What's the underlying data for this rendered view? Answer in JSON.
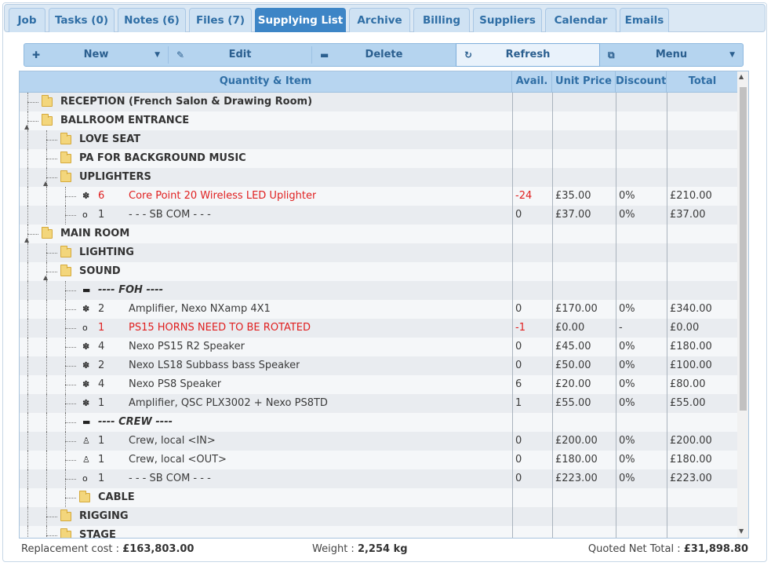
{
  "tabs": [
    {
      "label": "Job",
      "active": false
    },
    {
      "label": "Tasks (0)",
      "active": false
    },
    {
      "label": "Notes (6)",
      "active": false
    },
    {
      "label": "Files (7)",
      "active": false
    },
    {
      "label": "Supplying List",
      "active": true
    },
    {
      "label": "Archive",
      "active": false
    },
    {
      "label": "Billing",
      "active": false
    },
    {
      "label": "Suppliers",
      "active": false
    },
    {
      "label": "Calendar",
      "active": false
    },
    {
      "label": "Emails",
      "active": false
    }
  ],
  "toolbar": {
    "new_label": "New",
    "edit_label": "Edit",
    "delete_label": "Delete",
    "refresh_label": "Refresh",
    "menu_label": "Menu"
  },
  "columns": {
    "item": "Quantity & Item",
    "avail": "Avail.",
    "unit_price": "Unit Price",
    "discount": "Discount",
    "total": "Total"
  },
  "rows": [
    {
      "kind": "group",
      "level": 0,
      "expand": "",
      "label": "RECEPTION (French Salon & Drawing Room)"
    },
    {
      "kind": "group",
      "level": 0,
      "expand": "▲",
      "label": "BALLROOM ENTRANCE"
    },
    {
      "kind": "group",
      "level": 1,
      "expand": "",
      "label": "LOVE SEAT"
    },
    {
      "kind": "group",
      "level": 1,
      "expand": "",
      "label": "PA FOR BACKGROUND MUSIC"
    },
    {
      "kind": "group",
      "level": 1,
      "expand": "▲",
      "label": "UPLIGHTERS"
    },
    {
      "kind": "item",
      "level": 2,
      "icon": "✽",
      "icon_name": "gear-icon",
      "qty": "6",
      "name": "Core Point 20 Wireless LED Uplighter",
      "avail": "-24",
      "unit_price": "£35.00",
      "discount": "0%",
      "total": "£210.00",
      "red": true
    },
    {
      "kind": "item",
      "level": 2,
      "icon": "o",
      "icon_name": "circle-icon",
      "qty": "1",
      "name": "- - - SB COM - - -",
      "avail": "0",
      "unit_price": "£37.00",
      "discount": "0%",
      "total": "£37.00",
      "red": false
    },
    {
      "kind": "group",
      "level": 0,
      "expand": "▲",
      "label": "MAIN ROOM"
    },
    {
      "kind": "group",
      "level": 1,
      "expand": "",
      "label": "LIGHTING"
    },
    {
      "kind": "group",
      "level": 1,
      "expand": "▲",
      "label": "SOUND"
    },
    {
      "kind": "comment",
      "level": 2,
      "icon": "▬",
      "icon_name": "comment-icon",
      "label": "---- FOH ----"
    },
    {
      "kind": "item",
      "level": 2,
      "icon": "✽",
      "icon_name": "gear-icon",
      "qty": "2",
      "name": "Amplifier, Nexo NXamp 4X1",
      "avail": "0",
      "unit_price": "£170.00",
      "discount": "0%",
      "total": "£340.00",
      "red": false
    },
    {
      "kind": "item",
      "level": 2,
      "icon": "o",
      "icon_name": "circle-icon",
      "qty": "1",
      "name": "PS15 HORNS NEED TO BE ROTATED",
      "avail": "-1",
      "unit_price": "£0.00",
      "discount": "-",
      "total": "£0.00",
      "red": true
    },
    {
      "kind": "item",
      "level": 2,
      "icon": "✽",
      "icon_name": "gear-icon",
      "qty": "4",
      "name": "Nexo PS15 R2 Speaker",
      "avail": "0",
      "unit_price": "£45.00",
      "discount": "0%",
      "total": "£180.00",
      "red": false
    },
    {
      "kind": "item",
      "level": 2,
      "icon": "✽",
      "icon_name": "gear-icon",
      "qty": "2",
      "name": "Nexo LS18 Subbass bass Speaker",
      "avail": "0",
      "unit_price": "£50.00",
      "discount": "0%",
      "total": "£100.00",
      "red": false
    },
    {
      "kind": "item",
      "level": 2,
      "icon": "✽",
      "icon_name": "gear-icon",
      "qty": "4",
      "name": "Nexo PS8 Speaker",
      "avail": "6",
      "unit_price": "£20.00",
      "discount": "0%",
      "total": "£80.00",
      "red": false
    },
    {
      "kind": "item",
      "level": 2,
      "icon": "✽",
      "icon_name": "gear-icon",
      "qty": "1",
      "name": "Amplifier, QSC PLX3002 + Nexo PS8TD",
      "avail": "1",
      "unit_price": "£55.00",
      "discount": "0%",
      "total": "£55.00",
      "red": false
    },
    {
      "kind": "comment",
      "level": 2,
      "icon": "▬",
      "icon_name": "comment-icon",
      "label": "---- CREW ----"
    },
    {
      "kind": "item",
      "level": 2,
      "icon": "♙",
      "icon_name": "person-icon",
      "qty": "1",
      "name": "Crew, local <IN>",
      "avail": "0",
      "unit_price": "£200.00",
      "discount": "0%",
      "total": "£200.00",
      "red": false
    },
    {
      "kind": "item",
      "level": 2,
      "icon": "♙",
      "icon_name": "person-icon",
      "qty": "1",
      "name": "Crew, local <OUT>",
      "avail": "0",
      "unit_price": "£180.00",
      "discount": "0%",
      "total": "£180.00",
      "red": false
    },
    {
      "kind": "item",
      "level": 2,
      "icon": "o",
      "icon_name": "circle-icon",
      "qty": "1",
      "name": "- - - SB COM - - -",
      "avail": "0",
      "unit_price": "£223.00",
      "discount": "0%",
      "total": "£223.00",
      "red": false
    },
    {
      "kind": "group",
      "level": 2,
      "expand": "",
      "label": "CABLE"
    },
    {
      "kind": "group",
      "level": 1,
      "expand": "",
      "label": "RIGGING"
    },
    {
      "kind": "group",
      "level": 1,
      "expand": "",
      "label": "STAGE"
    }
  ],
  "footer": {
    "replacement_label": "Replacement cost :",
    "replacement_value": "£163,803.00",
    "weight_label": "Weight :",
    "weight_value": "2,254 kg",
    "quoted_label": "Quoted Net Total :",
    "quoted_value": "£31,898.80"
  }
}
